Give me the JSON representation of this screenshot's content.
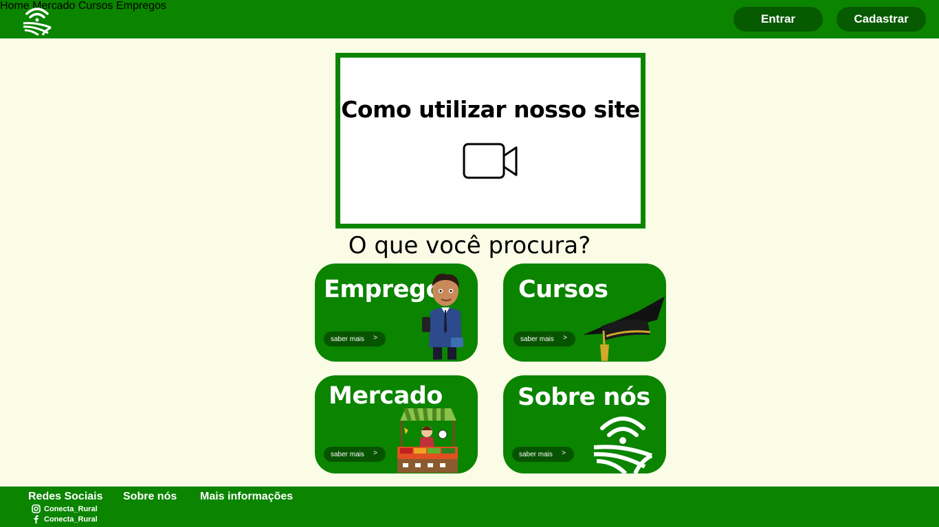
{
  "header": {
    "nav": [
      "Home",
      "Mercado",
      "Cursos",
      "Empregos"
    ],
    "login_label": "Entrar",
    "signup_label": "Cadastrar"
  },
  "video": {
    "title": "Como utilizar nosso site",
    "icon": "video-camera-icon"
  },
  "question": "O que você procura?",
  "cards": [
    {
      "title": "Emprego",
      "button": "saber mais",
      "arrow": ">"
    },
    {
      "title": "Cursos",
      "button": "saber mais",
      "arrow": ">"
    },
    {
      "title": "Mercado",
      "button": "saber mais",
      "arrow": ">"
    },
    {
      "title": "Sobre nós",
      "button": "saber mais",
      "arrow": ">"
    }
  ],
  "footer": {
    "links": [
      "Redes Sociais",
      "Sobre nós",
      "Mais informações"
    ],
    "social": [
      {
        "icon": "instagram-icon",
        "handle": "Conecta_Rural"
      },
      {
        "icon": "facebook-icon",
        "handle": "Conecta_Rural"
      }
    ]
  },
  "colors": {
    "brand_green": "#0b8400",
    "dark_green": "#065a00",
    "background": "#fafce6"
  }
}
